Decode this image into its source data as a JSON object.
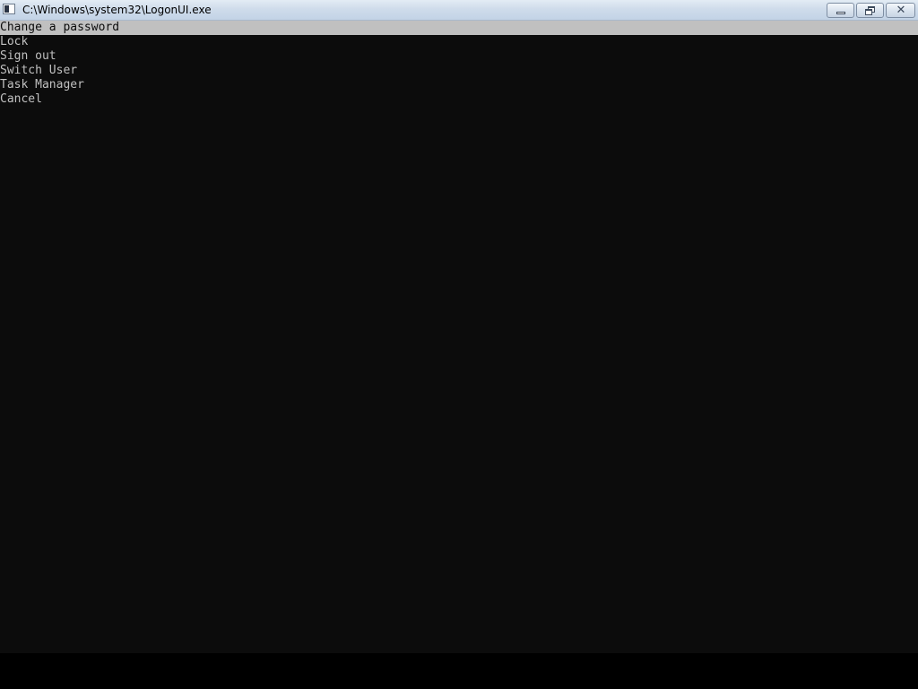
{
  "window": {
    "title": "C:\\Windows\\system32\\LogonUI.exe",
    "icon": "console-app-icon",
    "buttons": {
      "minimize": "minimize-icon",
      "restore": "restore-icon",
      "close": "close-icon"
    }
  },
  "menu": {
    "selected_index": 0,
    "items": [
      {
        "label": "Change a password"
      },
      {
        "label": "Lock"
      },
      {
        "label": "Sign out"
      },
      {
        "label": "Switch User"
      },
      {
        "label": "Task Manager"
      },
      {
        "label": "Cancel"
      }
    ]
  },
  "colors": {
    "console_background": "#0c0c0c",
    "console_text": "#c0c0c0",
    "selection_background": "#c0c0c0",
    "selection_text": "#0c0c0c"
  }
}
